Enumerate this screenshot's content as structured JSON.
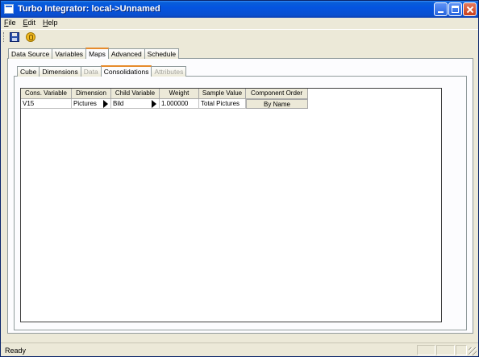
{
  "window": {
    "title": "Turbo Integrator:  local->Unnamed"
  },
  "menu": [
    {
      "accel": "F",
      "rest": "ile"
    },
    {
      "accel": "E",
      "rest": "dit"
    },
    {
      "accel": "H",
      "rest": "elp"
    }
  ],
  "toolbar": {
    "save_icon": "floppy-disk-icon",
    "run_icon": "gear-run-icon"
  },
  "main_tabs": [
    "Data Source",
    "Variables",
    "Maps",
    "Advanced",
    "Schedule"
  ],
  "sub_tabs": [
    "Cube",
    "Dimensions",
    "Data",
    "Consolidations",
    "Attributes"
  ],
  "grid": {
    "columns": [
      "Cons. Variable",
      "Dimension",
      "Child Variable",
      "Weight",
      "Sample Value",
      "Component Order"
    ],
    "rows": [
      {
        "cons_variable": "V15",
        "dimension": "Pictures",
        "child_variable": "Bild",
        "weight": "1.000000",
        "sample_value": "Total Pictures",
        "component_order": "By Name"
      }
    ]
  },
  "status": {
    "text": "Ready"
  },
  "colors": {
    "title_bar": "#0454e0",
    "active_tab_accent": "#e68b2c",
    "window_bg": "#ece9d8"
  }
}
